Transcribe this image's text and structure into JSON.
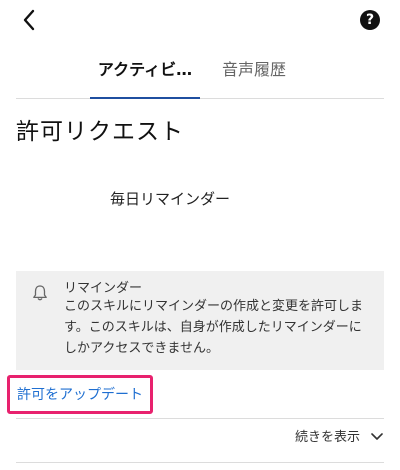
{
  "header": {
    "back_icon": "chevron-left-icon",
    "help_icon": "question-circle-icon",
    "help_symbol": "?"
  },
  "tabs": [
    {
      "label": "アクティビ…",
      "active": true
    },
    {
      "label": "音声履歴",
      "active": false
    }
  ],
  "page": {
    "title": "許可リクエスト",
    "reminder_label": "毎日リマインダー"
  },
  "info_box": {
    "icon": "bell-icon",
    "title": "リマインダー",
    "line1": "このスキルにリマインダーの作成と変更を許可しま",
    "line2": "す。このスキルは、自身が作成したリマインダーに",
    "line3": "しかアクセスできません。"
  },
  "actions": {
    "update_permission": "許可をアップデート",
    "show_more": "続きを表示",
    "show_more_icon": "chevron-down-icon"
  },
  "colors": {
    "accent": "#1f4fa0",
    "link": "#1f6fd1",
    "highlight_border": "#e8216e",
    "info_bg": "#f0f0f0"
  }
}
